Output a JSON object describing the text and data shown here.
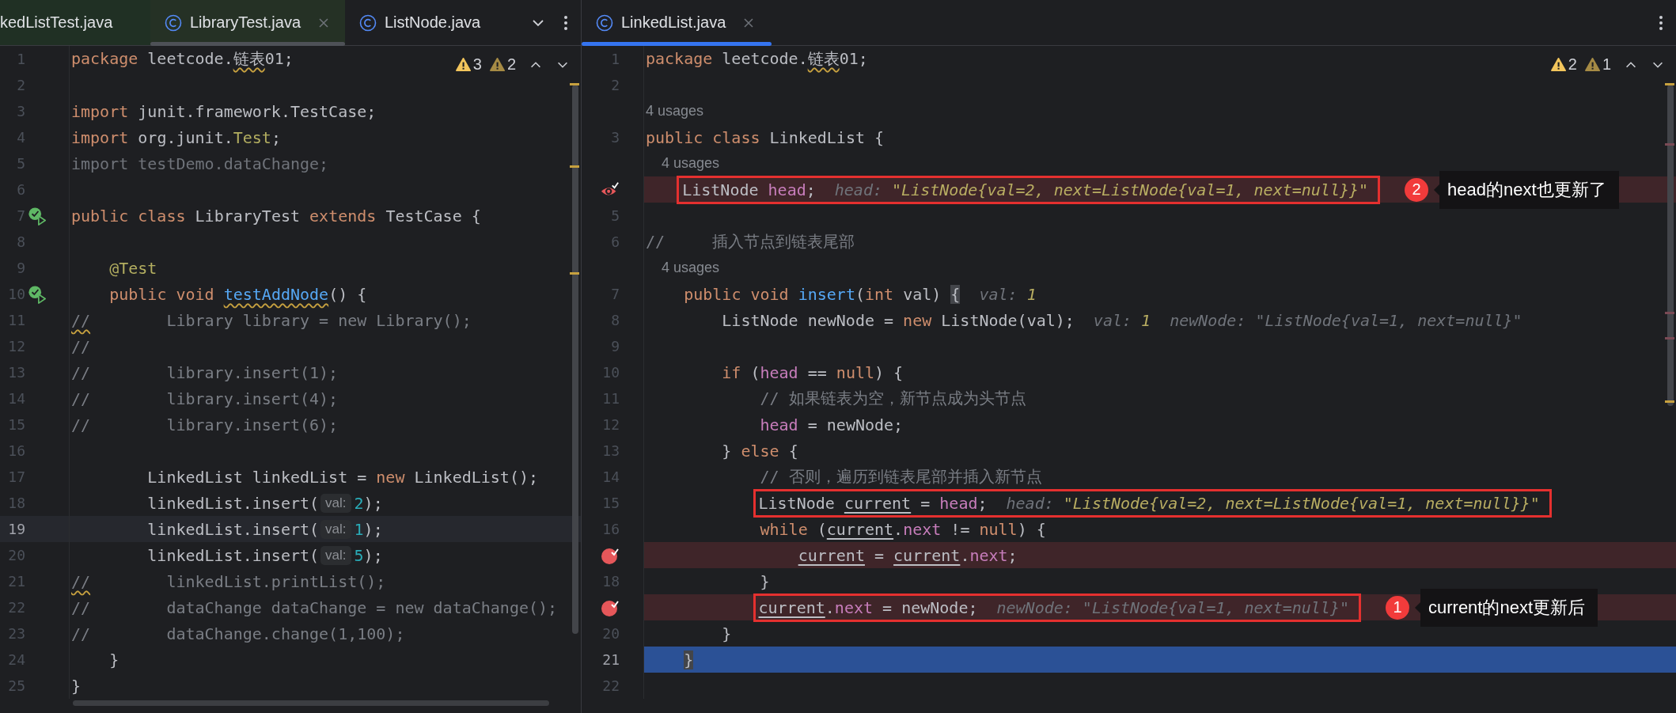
{
  "panes": [
    {
      "tabs": [
        {
          "label": "kedListTest.java",
          "class_icon": false,
          "test": true,
          "selected": false
        },
        {
          "label": "LibraryTest.java",
          "class_icon": true,
          "test": true,
          "selected": true
        },
        {
          "label": "ListNode.java",
          "class_icon": true,
          "test": false,
          "selected": false
        }
      ],
      "tab_overflow": true,
      "problems": [
        {
          "count": "3",
          "kind": "warning"
        },
        {
          "count": "2",
          "kind": "weak-warning"
        }
      ],
      "lines": [
        {
          "n": "1",
          "tokens": [
            {
              "t": "package ",
              "kind": "kw"
            },
            {
              "t": "leetcode.",
              "kind": "plain"
            },
            {
              "t": "链表",
              "kind": "warn"
            },
            {
              "t": "01;",
              "kind": "plain"
            }
          ]
        },
        {
          "n": "2"
        },
        {
          "n": "3",
          "tokens": [
            {
              "t": "import ",
              "kind": "kw"
            },
            {
              "t": "junit.framework.TestCase;",
              "kind": "plain"
            }
          ]
        },
        {
          "n": "4",
          "tokens": [
            {
              "t": "import ",
              "kind": "kw"
            },
            {
              "t": "org.junit.",
              "kind": "plain"
            },
            {
              "t": "Test",
              "kind": "ann"
            },
            {
              "t": ";",
              "kind": "plain"
            }
          ]
        },
        {
          "n": "5",
          "tokens": [
            {
              "t": "import testDemo.dataChange;",
              "kind": "unused"
            }
          ]
        },
        {
          "n": "6"
        },
        {
          "n": "7",
          "run_marker": true,
          "tokens": [
            {
              "t": "public class ",
              "kind": "kw"
            },
            {
              "t": "LibraryTest ",
              "kind": "plain"
            },
            {
              "t": "extends ",
              "kind": "kw"
            },
            {
              "t": "TestCase {",
              "kind": "plain"
            }
          ]
        },
        {
          "n": "8"
        },
        {
          "n": "9",
          "tokens": [
            {
              "t": "    @Test",
              "kind": "ann"
            }
          ]
        },
        {
          "n": "10",
          "run_marker": true,
          "tokens": [
            {
              "t": "    public void ",
              "kind": "kw"
            },
            {
              "t": "testAddNode",
              "kind": "fn-warn"
            },
            {
              "t": "() {",
              "kind": "plain"
            }
          ]
        },
        {
          "n": "11",
          "tokens": [
            {
              "t": "//",
              "kind": "comment-warn"
            },
            {
              "t": "        Library library = new Library();",
              "kind": "comment"
            }
          ]
        },
        {
          "n": "12",
          "tokens": [
            {
              "t": "//",
              "kind": "comment"
            }
          ]
        },
        {
          "n": "13",
          "tokens": [
            {
              "t": "//        library.insert(1);",
              "kind": "comment"
            }
          ]
        },
        {
          "n": "14",
          "tokens": [
            {
              "t": "//        library.insert(4);",
              "kind": "comment"
            }
          ]
        },
        {
          "n": "15",
          "tokens": [
            {
              "t": "//        library.insert(6);",
              "kind": "comment"
            }
          ]
        },
        {
          "n": "16"
        },
        {
          "n": "17",
          "tokens": [
            {
              "t": "        LinkedList linkedList = ",
              "kind": "plain"
            },
            {
              "t": "new ",
              "kind": "kw"
            },
            {
              "t": "LinkedList();",
              "kind": "plain"
            }
          ]
        },
        {
          "n": "18",
          "tokens": [
            {
              "t": "        linkedList.insert(",
              "kind": "plain"
            },
            {
              "t": "val:",
              "kind": "param"
            },
            {
              "t": "2",
              "kind": "num"
            },
            {
              "t": ");",
              "kind": "plain"
            }
          ]
        },
        {
          "n": "19",
          "caret_line": true,
          "tokens": [
            {
              "t": "        linkedList.insert(",
              "kind": "plain"
            },
            {
              "t": "val:",
              "kind": "param"
            },
            {
              "t": "1",
              "kind": "num"
            },
            {
              "t": ");",
              "kind": "plain"
            }
          ]
        },
        {
          "n": "20",
          "tokens": [
            {
              "t": "        linkedList.insert(",
              "kind": "plain"
            },
            {
              "t": "val:",
              "kind": "param"
            },
            {
              "t": "5",
              "kind": "num"
            },
            {
              "t": ");",
              "kind": "plain"
            }
          ]
        },
        {
          "n": "21",
          "tokens": [
            {
              "t": "//",
              "kind": "comment-warn"
            },
            {
              "t": "        linkedList.printList();",
              "kind": "comment"
            }
          ]
        },
        {
          "n": "22",
          "tokens": [
            {
              "t": "//        dataChange dataChange = new dataChange();",
              "kind": "comment"
            }
          ]
        },
        {
          "n": "23",
          "tokens": [
            {
              "t": "//        dataChange.change(1,100);",
              "kind": "comment"
            }
          ]
        },
        {
          "n": "24",
          "tokens": [
            {
              "t": "    }",
              "kind": "plain"
            }
          ]
        },
        {
          "n": "25",
          "tokens": [
            {
              "t": "}",
              "kind": "plain"
            }
          ]
        }
      ]
    },
    {
      "tabs": [
        {
          "label": "LinkedList.java",
          "class_icon": true,
          "test": false,
          "selected": true
        }
      ],
      "tab_overflow": false,
      "problems": [
        {
          "count": "2",
          "kind": "warning"
        },
        {
          "count": "1",
          "kind": "weak-warning"
        }
      ],
      "lines": [
        {
          "n": "1",
          "tokens": [
            {
              "t": "package ",
              "kind": "kw"
            },
            {
              "t": "leetcode.",
              "kind": "plain"
            },
            {
              "t": "链表",
              "kind": "warn"
            },
            {
              "t": "01;",
              "kind": "plain"
            }
          ]
        },
        {
          "n": "2"
        },
        {
          "kind": "usages",
          "text": "4 usages"
        },
        {
          "n": "3",
          "tokens": [
            {
              "t": "public class ",
              "kind": "kw"
            },
            {
              "t": "LinkedList {",
              "kind": "plain"
            }
          ]
        },
        {
          "kind": "usages",
          "text": "    4 usages"
        },
        {
          "breakpoint": true,
          "watch": true,
          "boxed": true,
          "callout": {
            "number": "2",
            "text": "head的next也更新了"
          },
          "tokens": [
            {
              "t": "    ListNode ",
              "kind": "plain"
            },
            {
              "t": "head",
              "kind": "field"
            },
            {
              "t": ";",
              "kind": "plain"
            },
            {
              "t": "head: ",
              "kind": "hint-label"
            },
            {
              "t": "\"ListNode{val=2, next=ListNode{val=1, next=null}}\"",
              "kind": "hint-value"
            }
          ]
        },
        {
          "n": "5"
        },
        {
          "n": "6",
          "tokens": [
            {
              "t": "//     插入节点到链表尾部",
              "kind": "comment"
            }
          ]
        },
        {
          "kind": "usages",
          "text": "    4 usages"
        },
        {
          "n": "7",
          "tokens": [
            {
              "t": "    public void ",
              "kind": "kw"
            },
            {
              "t": "insert",
              "kind": "fn"
            },
            {
              "t": "(",
              "kind": "plain"
            },
            {
              "t": "int ",
              "kind": "kw"
            },
            {
              "t": "val) ",
              "kind": "plain"
            },
            {
              "t": "{",
              "kind": "brace"
            },
            {
              "t": "val: ",
              "kind": "hint-label"
            },
            {
              "t": "1",
              "kind": "hint-value"
            }
          ]
        },
        {
          "n": "8",
          "tokens": [
            {
              "t": "        ListNode newNode = ",
              "kind": "plain"
            },
            {
              "t": "new ",
              "kind": "kw"
            },
            {
              "t": "ListNode(val);",
              "kind": "plain"
            },
            {
              "t": "val: ",
              "kind": "hint-label"
            },
            {
              "t": "1",
              "kind": "hint-value"
            },
            {
              "t": "newNode: ",
              "kind": "hint-label"
            },
            {
              "t": "\"ListNode{val=1, next=null}\"",
              "kind": "hint-dim"
            }
          ]
        },
        {
          "n": "9"
        },
        {
          "n": "10",
          "tokens": [
            {
              "t": "        if ",
              "kind": "kw"
            },
            {
              "t": "(",
              "kind": "plain"
            },
            {
              "t": "head",
              "kind": "field"
            },
            {
              "t": " == ",
              "kind": "plain"
            },
            {
              "t": "null",
              "kind": "kw"
            },
            {
              "t": ") {",
              "kind": "plain"
            }
          ]
        },
        {
          "n": "11",
          "tokens": [
            {
              "t": "            // 如果链表为空，新节点成为头节点",
              "kind": "comment"
            }
          ]
        },
        {
          "n": "12",
          "tokens": [
            {
              "t": "            head",
              "kind": "field"
            },
            {
              "t": " = newNode;",
              "kind": "plain"
            }
          ]
        },
        {
          "n": "13",
          "tokens": [
            {
              "t": "        } ",
              "kind": "plain"
            },
            {
              "t": "else ",
              "kind": "kw"
            },
            {
              "t": "{",
              "kind": "plain"
            }
          ]
        },
        {
          "n": "14",
          "tokens": [
            {
              "t": "            // 否则，遍历到链表尾部并插入新节点",
              "kind": "comment"
            }
          ]
        },
        {
          "n": "15",
          "boxed": true,
          "tokens": [
            {
              "t": "            ListNode ",
              "kind": "plain"
            },
            {
              "t": "current",
              "kind": "var"
            },
            {
              "t": " = ",
              "kind": "plain"
            },
            {
              "t": "head",
              "kind": "field"
            },
            {
              "t": ";",
              "kind": "plain"
            },
            {
              "t": "head: ",
              "kind": "hint-label"
            },
            {
              "t": "\"ListNode{val=2, next=ListNode{val=1, next=null}}\"",
              "kind": "hint-value"
            }
          ]
        },
        {
          "n": "16",
          "tokens": [
            {
              "t": "            while ",
              "kind": "kw"
            },
            {
              "t": "(",
              "kind": "plain"
            },
            {
              "t": "current",
              "kind": "var"
            },
            {
              "t": ".",
              "kind": "plain"
            },
            {
              "t": "next",
              "kind": "field"
            },
            {
              "t": " != ",
              "kind": "plain"
            },
            {
              "t": "null",
              "kind": "kw"
            },
            {
              "t": ") {",
              "kind": "plain"
            }
          ]
        },
        {
          "breakpoint": true,
          "watch": false,
          "tokens": [
            {
              "t": "                current",
              "kind": "var"
            },
            {
              "t": " = ",
              "kind": "plain"
            },
            {
              "t": "current",
              "kind": "var"
            },
            {
              "t": ".",
              "kind": "plain"
            },
            {
              "t": "next",
              "kind": "field"
            },
            {
              "t": ";",
              "kind": "plain"
            }
          ]
        },
        {
          "n": "18",
          "tokens": [
            {
              "t": "            }",
              "kind": "plain"
            }
          ]
        },
        {
          "breakpoint": true,
          "watch": false,
          "boxed": true,
          "callout": {
            "number": "1",
            "text": "current的next更新后"
          },
          "tokens": [
            {
              "t": "            current",
              "kind": "var"
            },
            {
              "t": ".",
              "kind": "plain"
            },
            {
              "t": "next",
              "kind": "field"
            },
            {
              "t": " = newNode;",
              "kind": "plain"
            },
            {
              "t": "newNode: ",
              "kind": "hint-label"
            },
            {
              "t": "\"ListNode{val=1, next=null}\"",
              "kind": "hint-dim"
            }
          ]
        },
        {
          "n": "20",
          "tokens": [
            {
              "t": "        }",
              "kind": "plain"
            }
          ]
        },
        {
          "n": "21",
          "execution_line": true,
          "tokens": [
            {
              "t": "    }",
              "kind": "brace"
            }
          ]
        },
        {
          "n": "22"
        }
      ]
    }
  ]
}
